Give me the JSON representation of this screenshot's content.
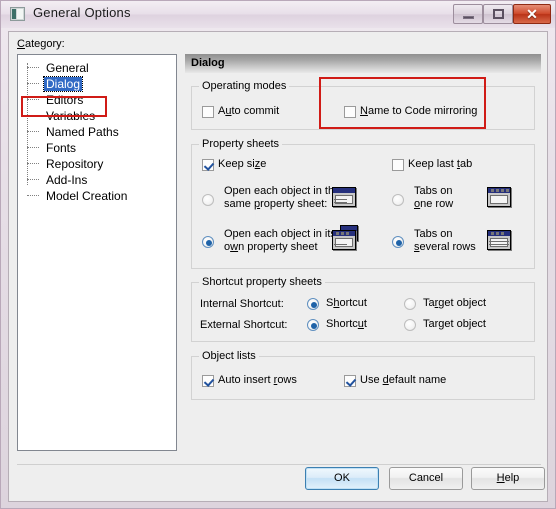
{
  "window": {
    "title": "General Options",
    "icon": "window-options-icon",
    "buttons": {
      "minimize": "minimize-icon",
      "maximize": "maximize-icon",
      "close": "✕"
    }
  },
  "category": {
    "label": "Category:",
    "label_accel": "C",
    "items": [
      {
        "label": "General",
        "selected": false
      },
      {
        "label": "Dialog",
        "selected": true
      },
      {
        "label": "Editors",
        "selected": false
      },
      {
        "label": "Variables",
        "selected": false
      },
      {
        "label": "Named Paths",
        "selected": false
      },
      {
        "label": "Fonts",
        "selected": false
      },
      {
        "label": "Repository",
        "selected": false
      },
      {
        "label": "Add-Ins",
        "selected": false
      },
      {
        "label": "Model Creation",
        "selected": false
      }
    ]
  },
  "pane": {
    "header": "Dialog",
    "operating_modes": {
      "title": "Operating modes",
      "auto_commit": {
        "label_pre": "A",
        "label_accel": "u",
        "label_post": "to commit",
        "full": "Auto commit",
        "checked": false
      },
      "name_to_code": {
        "label_pre": "",
        "label_accel": "N",
        "label_post": "ame to Code mirroring",
        "full": "Name to Code mirroring",
        "checked": false
      }
    },
    "property_sheets": {
      "title": "Property sheets",
      "keep_size": {
        "pre": "Keep si",
        "accel": "z",
        "post": "e",
        "full": "Keep size",
        "checked": true
      },
      "keep_last_tab": {
        "pre": "Keep last ",
        "accel": "t",
        "post": "ab",
        "full": "Keep last tab",
        "checked": false
      },
      "open_same": {
        "line1_pre": "Open each object in the",
        "line2_pre": "same ",
        "line2_accel": "p",
        "line2_post": "roperty sheet:",
        "full": "Open each object in the same property sheet:",
        "selected": false,
        "icon": "single-property-sheet-icon"
      },
      "open_own": {
        "line1_pre": "Open each object in its",
        "line2_pre": "o",
        "line2_accel": "w",
        "line2_post": "n property sheet",
        "full": "Open each object in its own property sheet",
        "selected": true,
        "icon": "multiple-property-sheets-icon"
      },
      "tabs_one_row": {
        "line1": "Tabs on",
        "line2_pre": "",
        "line2_accel": "o",
        "line2_post": "ne row",
        "full": "Tabs on one row",
        "selected": false,
        "icon": "tabs-one-row-icon"
      },
      "tabs_several_rows": {
        "line1": "Tabs on",
        "line2_pre": "",
        "line2_accel": "s",
        "line2_post": "everal rows",
        "full": "Tabs on several rows",
        "selected": true,
        "icon": "tabs-several-rows-icon"
      }
    },
    "shortcut_property_sheets": {
      "title": "Shortcut property sheets",
      "internal_label": "Internal Shortcut:",
      "external_label": "External Shortcut:",
      "internal_shortcut": {
        "pre": "S",
        "accel": "h",
        "post": "ortcut",
        "full": "Shortcut",
        "selected": true
      },
      "internal_target": {
        "pre": "Ta",
        "accel": "r",
        "post": "get object",
        "full": "Target object",
        "selected": false
      },
      "external_shortcut": {
        "pre": "Shortc",
        "accel": "u",
        "post": "t",
        "full": "Shortcut",
        "selected": true
      },
      "external_target": {
        "pre": "Tar",
        "accel": "g",
        "post": "et object",
        "full": "Target object",
        "selected": false
      }
    },
    "object_lists": {
      "title": "Object lists",
      "auto_insert_rows": {
        "pre": "Auto insert ",
        "accel": "r",
        "post": "ows",
        "full": "Auto insert rows",
        "checked": true
      },
      "use_default_name": {
        "pre": "Use ",
        "accel": "d",
        "post": "efault name",
        "full": "Use default name",
        "checked": true
      }
    }
  },
  "footer": {
    "ok": "OK",
    "cancel": "Cancel",
    "help_pre": "",
    "help_accel": "H",
    "help_post": "elp",
    "help_full": "Help"
  },
  "annotations": {
    "highlight_color": "#d01b16",
    "selection_color": "#316ac5",
    "count": 2
  }
}
